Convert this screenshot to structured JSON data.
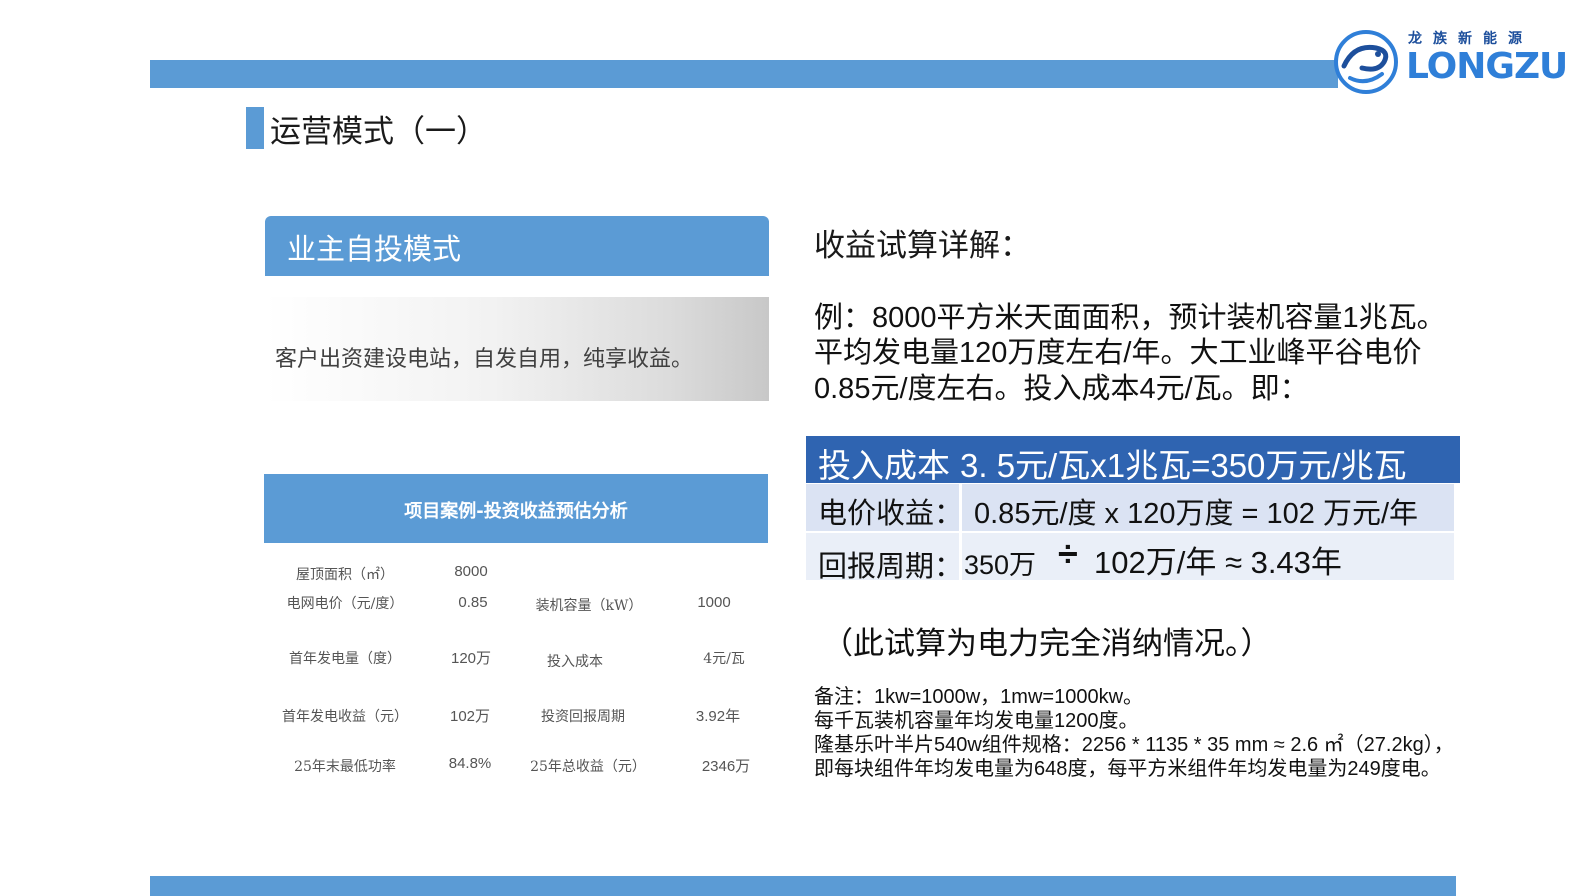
{
  "logo": {
    "cn": "龙族新能源",
    "en": "LONGZU",
    "colors": {
      "primary": "#1d4f9c",
      "accent": "#2f7fd8"
    }
  },
  "page": {
    "title": "运营模式（一）",
    "accent_color": "#5b9bd5"
  },
  "mode": {
    "title": "业主自投模式",
    "description": "客户出资建设电站，自发自用，纯享收益。"
  },
  "project": {
    "title": "项目案例-投资收益预估分析",
    "rows": [
      {
        "l1": "屋顶面积（㎡）",
        "v1": "8000",
        "l2": "",
        "v2": ""
      },
      {
        "l1": "电网电价（元/度）",
        "v1": "0.85",
        "l2": "装机容量（kW）",
        "v2": "1000"
      },
      {
        "l1": "首年发电量（度）",
        "v1": "120万",
        "l2": "投入成本",
        "v2": "4元/瓦"
      },
      {
        "l1": "首年发电收益（元）",
        "v1": "102万",
        "l2": "投资回报周期",
        "v2": "3.92年"
      },
      {
        "l1": "25年末最低功率",
        "v1": "84.8%",
        "l2": "25年总收益（元）",
        "v2": "2346万"
      }
    ]
  },
  "calc": {
    "heading": "收益试算详解：",
    "example_lines": [
      "例：8000平方米天面面积，预计装机容量1兆瓦。",
      "平均发电量120万度左右/年。大工业峰平谷电价",
      "0.85元/度左右。投入成本4元/瓦。即："
    ],
    "cost_label": "投入成本",
    "cost_formula": "3. 5元/瓦x1兆瓦=350万元/兆瓦",
    "revenue_label": "电价收益：",
    "revenue_value": "0.85元/度 x 120万度 = 102 万元/年",
    "payback_label": "回报周期：",
    "payback_value_1": "350万",
    "payback_divide": "÷",
    "payback_value_2": "102万/年  ≈ 3.43年",
    "note": "（此试算为电力完全消纳情况。）",
    "remarks": [
      "备注：1kw=1000w，1mw=1000kw。",
      "每千瓦装机容量年均发电量1200度。",
      "隆基乐叶半片540w组件规格：2256 * 1135 * 35 mm ≈ 2.6 ㎡（27.2kg），",
      "即每块组件年均发电量为648度，每平方米组件年均发电量为249度电。"
    ]
  },
  "colors": {
    "bar": "#5b9bd5",
    "cost_row": "#2f64b1",
    "table_light": "#dbe3f3"
  }
}
